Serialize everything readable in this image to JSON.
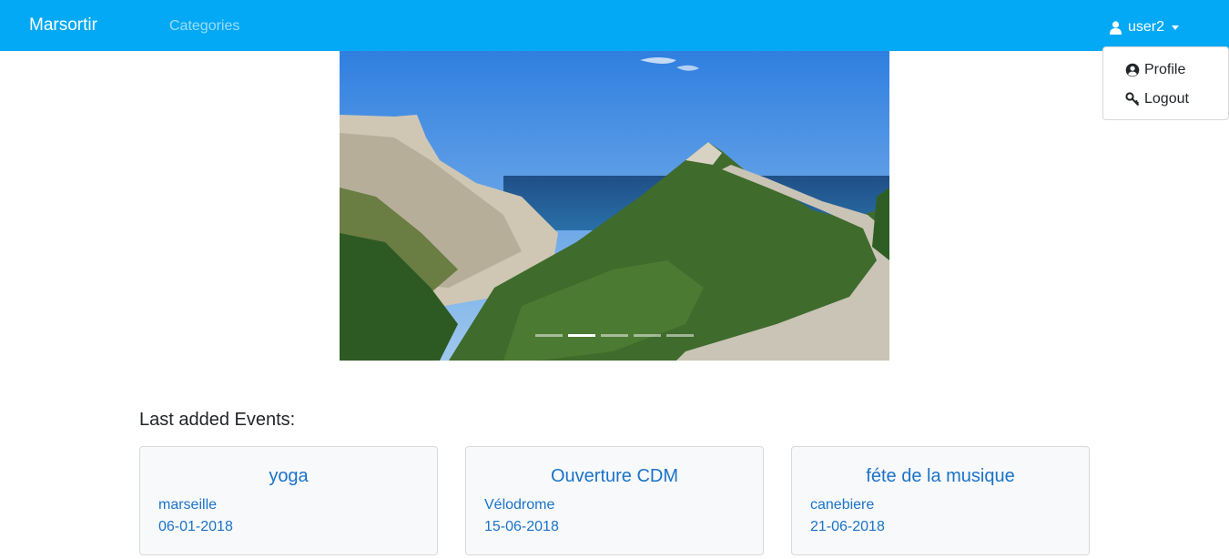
{
  "navbar": {
    "brand": "Marsortir",
    "categories_link": "Categories",
    "user_name": "user2",
    "user_icon": "user-icon",
    "background_color": "#03a9f4"
  },
  "user_menu": {
    "items": [
      {
        "label": "Profile",
        "icon": "user-circle-icon"
      },
      {
        "label": "Logout",
        "icon": "key-icon"
      }
    ]
  },
  "carousel": {
    "image_description_icon": "landscape-photo",
    "slide_count": 5,
    "active_slide": 2
  },
  "events": {
    "heading": "Last added Events:",
    "items": [
      {
        "title": "yoga",
        "place": "marseille",
        "date": "06-01-2018"
      },
      {
        "title": "Ouverture CDM",
        "place": "Vélodrome",
        "date": "15-06-2018"
      },
      {
        "title": "féte de la musique",
        "place": "canebiere",
        "date": "21-06-2018"
      }
    ],
    "link_color": "#1a73c9"
  }
}
